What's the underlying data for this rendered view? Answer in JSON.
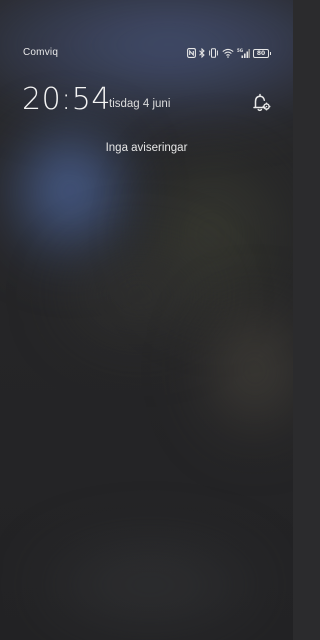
{
  "status_bar": {
    "carrier": "Comviq",
    "network_type": "5G",
    "battery_level": "80",
    "icons": [
      "nfc-icon",
      "bluetooth-icon",
      "vibrate-icon",
      "wifi-icon",
      "signal-icon",
      "battery-icon"
    ]
  },
  "clock": {
    "time": "20:54",
    "date": "tisdag 4 juni"
  },
  "notifications": {
    "empty_message": "Inga aviseringar"
  },
  "colors": {
    "text_primary": "#f4f4f4",
    "wallpaper_blue": "#5f7dbe",
    "background": "#2a2a2c"
  }
}
